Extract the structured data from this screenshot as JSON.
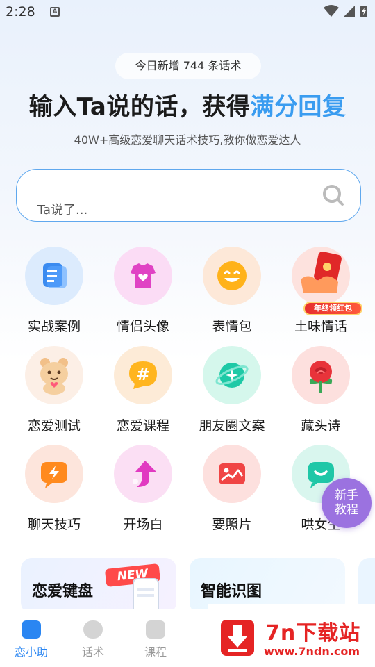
{
  "status_bar": {
    "time": "2:28",
    "notification_glyph": "A"
  },
  "hero": {
    "counter_text": "今日新增 744 条话术",
    "headline_main": "输入Ta说的话，获得",
    "headline_accent": "满分回复",
    "subline": "40W+高级恋爱聊天话术技巧,教你做恋爱达人"
  },
  "search": {
    "placeholder": "Ta说了..."
  },
  "features": [
    {
      "label": "实战案例",
      "icon": "document-stack-icon",
      "color": "#3b8bf0"
    },
    {
      "label": "情侣头像",
      "icon": "tshirt-heart-icon",
      "color": "#e043c4"
    },
    {
      "label": "表情包",
      "icon": "smiley-face-icon",
      "color": "#ffb21a"
    },
    {
      "label": "土味情话",
      "icon": "red-envelope-icon",
      "color": "#e03030"
    },
    {
      "label": "恋爱测试",
      "icon": "bear-mascot-icon",
      "color": "#f2c089"
    },
    {
      "label": "恋爱课程",
      "icon": "hashtag-bubble-icon",
      "color": "#ffb51f"
    },
    {
      "label": "朋友圈文案",
      "icon": "planet-sparkle-icon",
      "color": "#1ec9a6"
    },
    {
      "label": "藏头诗",
      "icon": "rose-icon",
      "color": "#e8333a"
    },
    {
      "label": "聊天技巧",
      "icon": "lightning-bubble-icon",
      "color": "#ff8a1e"
    },
    {
      "label": "开场白",
      "icon": "arrow-up-icon",
      "color": "#e13ac1"
    },
    {
      "label": "要照片",
      "icon": "photo-icon",
      "color": "#f04545"
    },
    {
      "label": "哄女生",
      "icon": "smile-bubble-icon",
      "color": "#1fc7a7"
    }
  ],
  "promo_tag": "年终领红包",
  "float_button": {
    "line1": "新手",
    "line2": "教程"
  },
  "cards": [
    {
      "title": "恋爱键盘",
      "badge": "NEW"
    },
    {
      "title": "智能识图"
    }
  ],
  "tabs": [
    {
      "label": "恋小助",
      "active": true
    },
    {
      "label": "话术",
      "active": false
    },
    {
      "label": "课程",
      "active": false
    }
  ],
  "watermark": {
    "title": "7n下载站",
    "url": "www.7ndn.com"
  },
  "colors": {
    "accent": "#3a9cf0",
    "tab_active": "#2a86f2",
    "float": "#9b72e0"
  }
}
